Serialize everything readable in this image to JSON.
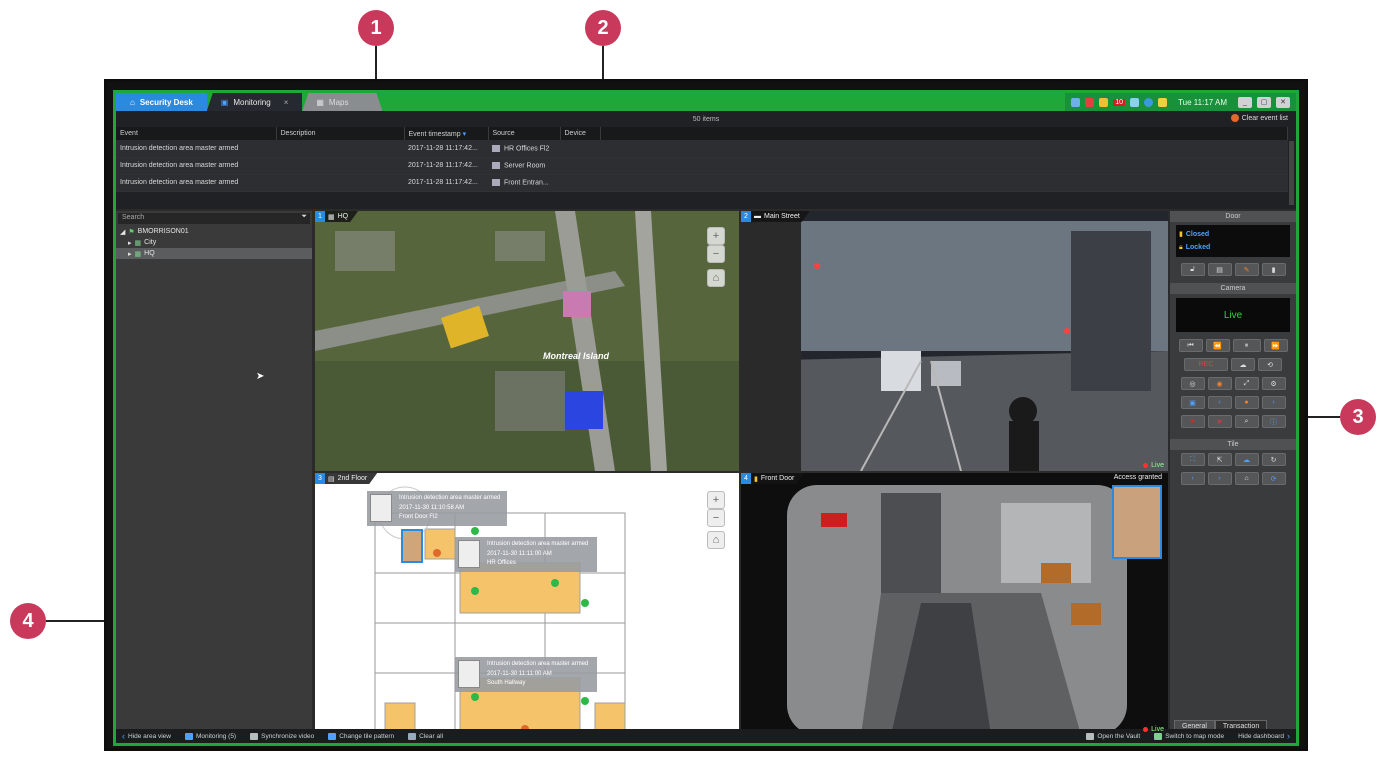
{
  "callouts": [
    "1",
    "2",
    "3",
    "4"
  ],
  "tabs": {
    "home": "Security Desk",
    "monitoring": "Monitoring",
    "maps": "Maps"
  },
  "tray": {
    "badge": "10",
    "clock": "Tue 11:17 AM"
  },
  "events": {
    "count": "50 items",
    "clear": "Clear event list",
    "columns": [
      "Event",
      "Description",
      "Event timestamp",
      "Source",
      "Device"
    ],
    "rows": [
      {
        "event": "Intrusion detection area master armed",
        "timestamp": "2017-11-28 11:17:42...",
        "source": "HR Offices Fl2"
      },
      {
        "event": "Intrusion detection area master armed",
        "timestamp": "2017-11-28 11:17:42...",
        "source": "Server Room"
      },
      {
        "event": "Intrusion detection area master armed",
        "timestamp": "2017-11-28 11:17:42...",
        "source": "Front Entran..."
      }
    ]
  },
  "area_view": {
    "search_placeholder": "Search",
    "tree": [
      "BMORRISON01",
      "City",
      "HQ"
    ]
  },
  "tiles": {
    "t1": {
      "num": "1",
      "title": "HQ",
      "map_label": "Montreal Island"
    },
    "t2": {
      "num": "2",
      "title": "Main Street",
      "live": "Live"
    },
    "t3": {
      "num": "3",
      "title": "2nd Floor",
      "cards": [
        {
          "line1": "Intrusion detection area master armed",
          "line2": "2017-11-30 11:10:58 AM",
          "line3": "Front Door Fl2"
        },
        {
          "line1": "Intrusion detection area master armed",
          "line2": "2017-11-30 11:11:00 AM",
          "line3": "HR Offices"
        },
        {
          "line1": "Intrusion detection area master armed",
          "line2": "2017-11-30 11:11:00 AM",
          "line3": "South Hallway"
        }
      ]
    },
    "t4": {
      "num": "4",
      "title": "Front Door",
      "access": "Access granted",
      "live": "Live"
    }
  },
  "dashboard": {
    "door_title": "Door",
    "door_state1": "Closed",
    "door_state2": "Locked",
    "camera_title": "Camera",
    "camera_live": "Live",
    "rec_label": "REC",
    "tile_title": "Tile",
    "tab_general": "General",
    "tab_transaction": "Transaction"
  },
  "statusbar": {
    "hide_area": "Hide area view",
    "monitoring": "Monitoring (5)",
    "sync": "Synchronize video",
    "pattern": "Change tile pattern",
    "clear": "Clear all",
    "vault": "Open the Vault",
    "map_mode": "Switch to map mode",
    "hide_dash": "Hide dashboard"
  },
  "colors": {
    "frame_green": "#1fa83a",
    "callout": "#c8395b",
    "accent_blue": "#2a8ae0"
  }
}
